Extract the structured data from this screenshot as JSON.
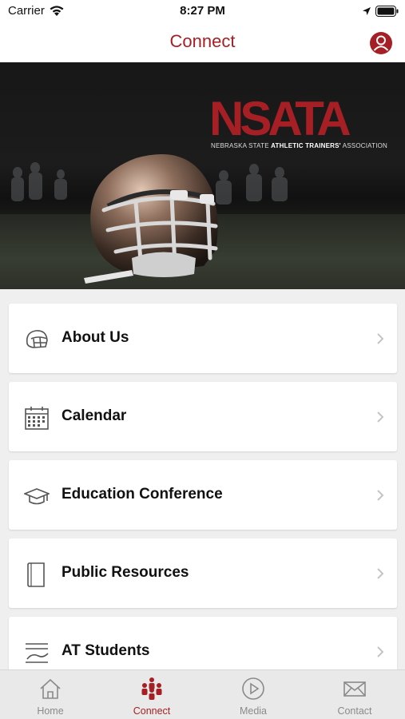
{
  "status_bar": {
    "carrier": "Carrier",
    "time": "8:27 PM"
  },
  "nav": {
    "title": "Connect",
    "profile_icon": "person-circle-icon"
  },
  "hero": {
    "logo_text": "NSATA",
    "logo_sub_prefix": "NEBRASKA STATE ",
    "logo_sub_bold": "ATHLETIC TRAINERS'",
    "logo_sub_suffix": " ASSOCIATION"
  },
  "menu": {
    "items": [
      {
        "label": "About Us",
        "icon": "helmet-icon"
      },
      {
        "label": "Calendar",
        "icon": "calendar-icon"
      },
      {
        "label": "Education Conference",
        "icon": "graduation-cap-icon"
      },
      {
        "label": "Public Resources",
        "icon": "book-icon"
      },
      {
        "label": "AT Students",
        "icon": "students-icon"
      }
    ]
  },
  "tab_bar": {
    "tabs": [
      {
        "label": "Home",
        "icon": "home-icon",
        "active": false
      },
      {
        "label": "Connect",
        "icon": "people-icon",
        "active": true
      },
      {
        "label": "Media",
        "icon": "play-icon",
        "active": false
      },
      {
        "label": "Contact",
        "icon": "envelope-icon",
        "active": false
      }
    ]
  },
  "colors": {
    "accent": "#a61f24",
    "inactive": "#8a8a8a",
    "background": "#efefef"
  }
}
